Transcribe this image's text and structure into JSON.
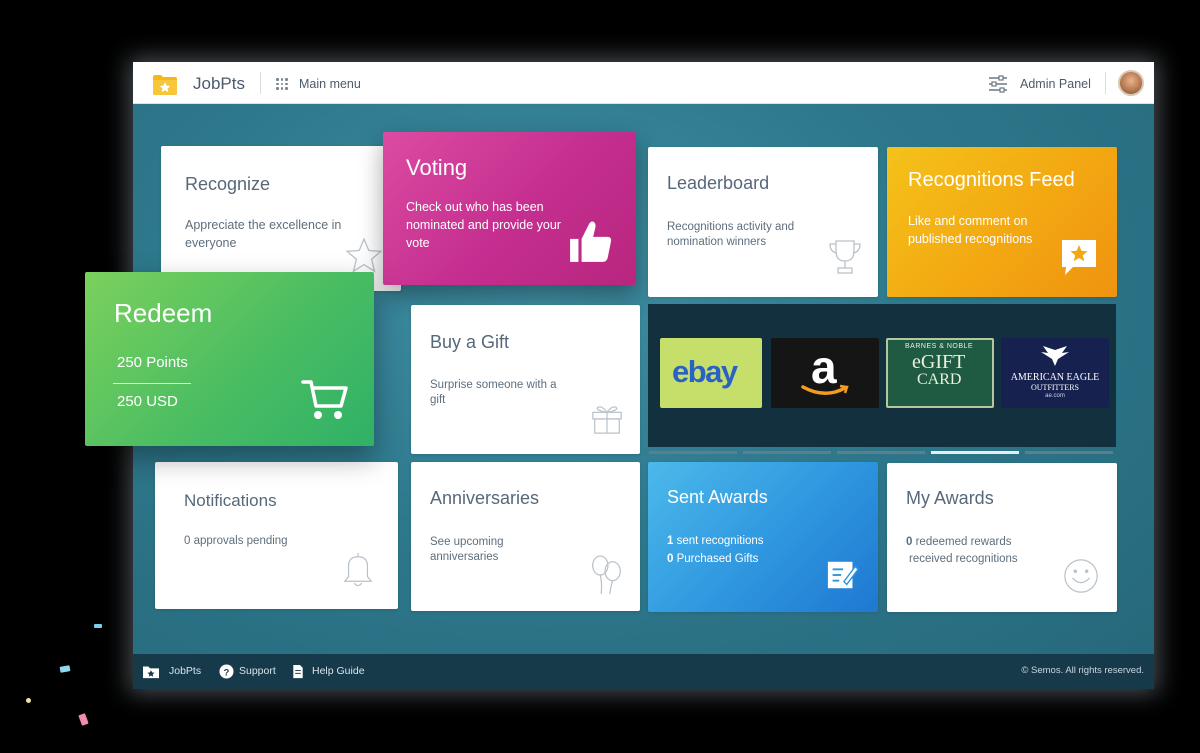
{
  "topbar": {
    "brand": "JobPts",
    "main_menu": "Main menu",
    "admin_panel": "Admin Panel"
  },
  "tiles": {
    "recognize": {
      "title": "Recognize",
      "desc": "Appreciate the excellence in everyone"
    },
    "voting": {
      "title": "Voting",
      "desc": "Check out who has been nominated and provide your vote"
    },
    "leaderboard": {
      "title": "Leaderboard",
      "desc": "Recognitions activity and nomination winners"
    },
    "feed": {
      "title": "Recognitions Feed",
      "desc": "Like and comment on published recognitions"
    },
    "redeem": {
      "title": "Redeem",
      "points": "250 Points",
      "usd": "250 USD"
    },
    "gift": {
      "title": "Buy a Gift",
      "desc": "Surprise someone with a gift"
    },
    "notifications": {
      "title": "Notifications",
      "desc": "0 approvals pending"
    },
    "anniversaries": {
      "title": "Anniversaries",
      "desc": "See upcoming anniversaries"
    },
    "sent": {
      "title": "Sent Awards",
      "count1": "1",
      "line1": " sent recognitions",
      "count2": "0",
      "line2": " Purchased Gifts"
    },
    "my": {
      "title": "My Awards",
      "count1": "0",
      "line1": " redeemed rewards",
      "line2": "received recognitions"
    }
  },
  "giftcards": {
    "ebay": "ebay",
    "amazon": "a",
    "bn_top": "BARNES & NOBLE",
    "bn_main": "eGIFT",
    "bn_main2": "CARD",
    "ae_line1": "AMERICAN EAGLE",
    "ae_line2": "OUTFITTERS",
    "ae_line3": "ae.com"
  },
  "footer": {
    "brand": "JobPts",
    "support": "Support",
    "help": "Help Guide",
    "copyright": "© Semos. All rights reserved."
  },
  "colors": {
    "voting": "#c42e8f",
    "feed": "#f3a812",
    "redeem": "#4bbd62",
    "sent": "#2e96df",
    "footer": "#173a4a"
  }
}
